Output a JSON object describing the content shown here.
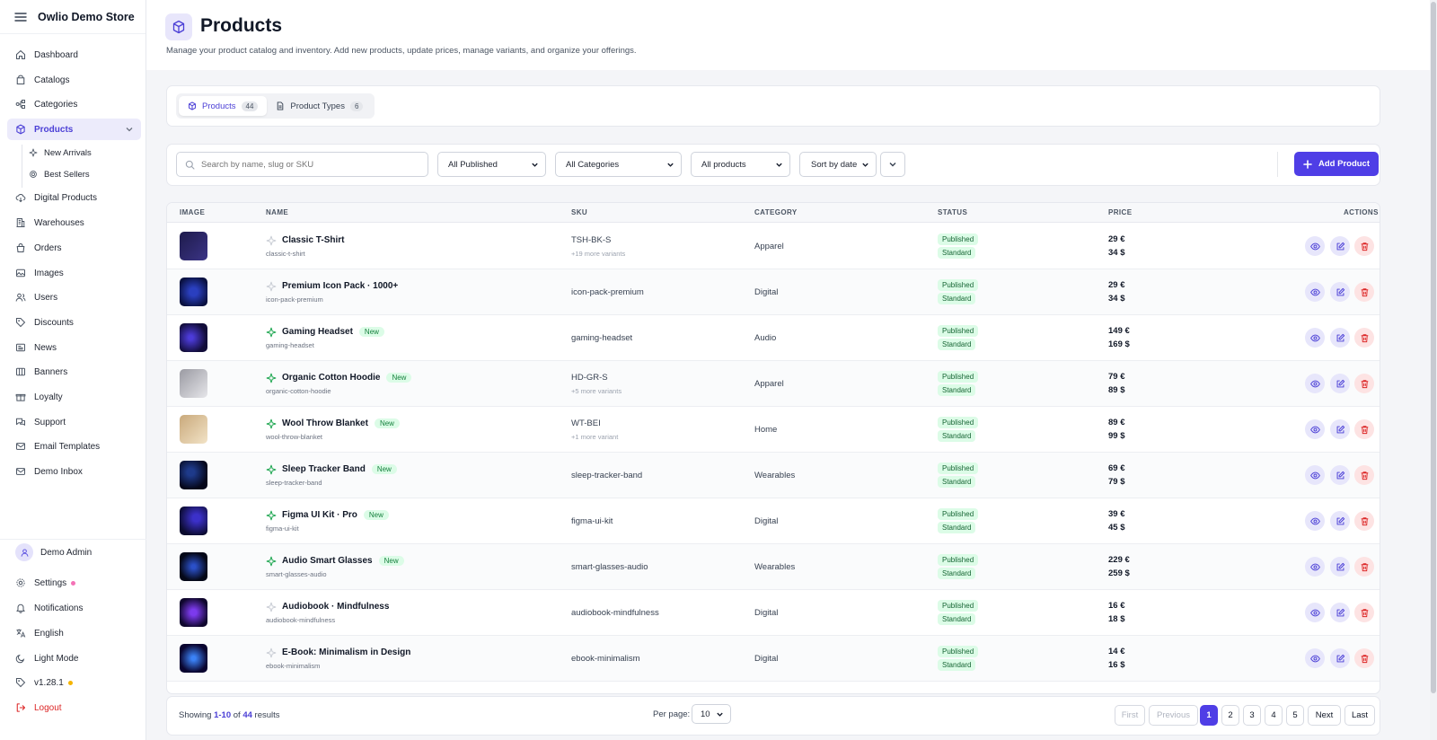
{
  "app": {
    "name": "Owlio Demo Store"
  },
  "sidebar": {
    "items": [
      {
        "label": "Dashboard",
        "icon": "home-icon"
      },
      {
        "label": "Catalogs",
        "icon": "catalog-icon"
      },
      {
        "label": "Categories",
        "icon": "categories-icon"
      },
      {
        "label": "Products",
        "icon": "box-icon",
        "active": true
      },
      {
        "label": "Digital Products",
        "icon": "cloud-download-icon"
      },
      {
        "label": "Warehouses",
        "icon": "building-icon"
      },
      {
        "label": "Orders",
        "icon": "bag-icon"
      },
      {
        "label": "Images",
        "icon": "image-icon"
      },
      {
        "label": "Users",
        "icon": "users-icon"
      },
      {
        "label": "Discounts",
        "icon": "tag-icon"
      },
      {
        "label": "News",
        "icon": "news-icon"
      },
      {
        "label": "Banners",
        "icon": "banner-icon"
      },
      {
        "label": "Loyalty",
        "icon": "gift-icon"
      },
      {
        "label": "Support",
        "icon": "chat-icon"
      },
      {
        "label": "Email Templates",
        "icon": "mail-icon"
      },
      {
        "label": "Demo Inbox",
        "icon": "inbox-icon"
      }
    ],
    "sub_items": [
      {
        "label": "New Arrivals",
        "icon": "sparkle-icon"
      },
      {
        "label": "Best Sellers",
        "icon": "award-icon"
      }
    ],
    "user": {
      "name": "Demo Admin"
    },
    "bottom": [
      {
        "label": "Settings",
        "icon": "gear-icon",
        "dot_color": "#f472b6"
      },
      {
        "label": "Notifications",
        "icon": "bell-icon"
      },
      {
        "label": "English",
        "icon": "translate-icon"
      },
      {
        "label": "Light Mode",
        "icon": "moon-icon"
      },
      {
        "label": "v1.28.1",
        "icon": "tag-outline-icon",
        "dot_color": "#f5b400"
      },
      {
        "label": "Logout",
        "icon": "logout-icon",
        "color": "#dc2626"
      }
    ]
  },
  "header": {
    "title": "Products",
    "description": "Manage your product catalog and inventory. Add new products, update prices, manage variants, and organize your offerings."
  },
  "tabs": [
    {
      "label": "Products",
      "count": "44",
      "active": true
    },
    {
      "label": "Product Types",
      "count": "6"
    }
  ],
  "filters": {
    "search_placeholder": "Search by name, slug or SKU",
    "published": "All Published",
    "categories": "All Categories",
    "products": "All products",
    "sort": "Sort by date",
    "add_label": "Add Product"
  },
  "table": {
    "columns": [
      "IMAGE",
      "NAME",
      "SKU",
      "CATEGORY",
      "STATUS",
      "PRICE",
      "ACTIONS"
    ],
    "new_label": "New",
    "rows": [
      {
        "name": "Classic T-Shirt",
        "slug": "classic-t-shirt",
        "sku": "TSH-BK-S",
        "sku_sub": "+19 more variants",
        "category": "Apparel",
        "status": "Published",
        "type": "Standard",
        "price_eur": "29 €",
        "price_usd": "34 $",
        "is_new": false
      },
      {
        "name": "Premium Icon Pack · 1000+",
        "slug": "icon-pack-premium",
        "sku": "icon-pack-premium",
        "sku_sub": "",
        "category": "Digital",
        "status": "Published",
        "type": "Standard",
        "price_eur": "29 €",
        "price_usd": "34 $",
        "is_new": false
      },
      {
        "name": "Gaming Headset",
        "slug": "gaming-headset",
        "sku": "gaming-headset",
        "sku_sub": "",
        "category": "Audio",
        "status": "Published",
        "type": "Standard",
        "price_eur": "149 €",
        "price_usd": "169 $",
        "is_new": true
      },
      {
        "name": "Organic Cotton Hoodie",
        "slug": "organic-cotton-hoodie",
        "sku": "HD-GR-S",
        "sku_sub": "+5 more variants",
        "category": "Apparel",
        "status": "Published",
        "type": "Standard",
        "price_eur": "79 €",
        "price_usd": "89 $",
        "is_new": true
      },
      {
        "name": "Wool Throw Blanket",
        "slug": "wool-throw-blanket",
        "sku": "WT-BEI",
        "sku_sub": "+1 more variant",
        "category": "Home",
        "status": "Published",
        "type": "Standard",
        "price_eur": "89 €",
        "price_usd": "99 $",
        "is_new": true
      },
      {
        "name": "Sleep Tracker Band",
        "slug": "sleep-tracker-band",
        "sku": "sleep-tracker-band",
        "sku_sub": "",
        "category": "Wearables",
        "status": "Published",
        "type": "Standard",
        "price_eur": "69 €",
        "price_usd": "79 $",
        "is_new": true
      },
      {
        "name": "Figma UI Kit · Pro",
        "slug": "figma-ui-kit",
        "sku": "figma-ui-kit",
        "sku_sub": "",
        "category": "Digital",
        "status": "Published",
        "type": "Standard",
        "price_eur": "39 €",
        "price_usd": "45 $",
        "is_new": true
      },
      {
        "name": "Audio Smart Glasses",
        "slug": "smart-glasses-audio",
        "sku": "smart-glasses-audio",
        "sku_sub": "",
        "category": "Wearables",
        "status": "Published",
        "type": "Standard",
        "price_eur": "229 €",
        "price_usd": "259 $",
        "is_new": true
      },
      {
        "name": "Audiobook · Mindfulness",
        "slug": "audiobook-mindfulness",
        "sku": "audiobook-mindfulness",
        "sku_sub": "",
        "category": "Digital",
        "status": "Published",
        "type": "Standard",
        "price_eur": "16 €",
        "price_usd": "18 $",
        "is_new": false
      },
      {
        "name": "E-Book: Minimalism in Design",
        "slug": "ebook-minimalism",
        "sku": "ebook-minimalism",
        "sku_sub": "",
        "category": "Digital",
        "status": "Published",
        "type": "Standard",
        "price_eur": "14 €",
        "price_usd": "16 $",
        "is_new": false
      }
    ]
  },
  "pagination": {
    "showing_prefix": "Showing",
    "range": "1-10",
    "of": "of",
    "total": "44",
    "suffix": "results",
    "per_page_label": "Per page:",
    "per_page": "10",
    "buttons": [
      "First",
      "Previous",
      "1",
      "2",
      "3",
      "4",
      "5",
      "Next",
      "Last"
    ],
    "current": "1"
  },
  "colors": {
    "accent": "#4f3ee6",
    "published_bg": "#dcfce7",
    "delete": "#dc2626"
  }
}
